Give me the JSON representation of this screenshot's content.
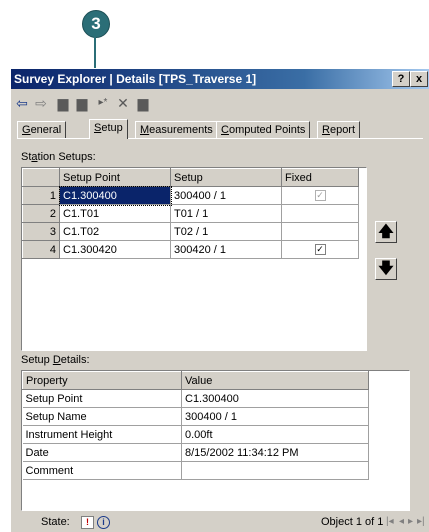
{
  "callout": {
    "number": "3"
  },
  "window": {
    "title": "Survey Explorer | Details [TPS_Traverse 1]",
    "help_button": "?",
    "close_button": "x"
  },
  "toolbar": {
    "back": "⇦",
    "forward": "⇨",
    "new": "▆",
    "save": "▆",
    "insert": "▸*",
    "delete": "✕",
    "props": "▆"
  },
  "tabs": [
    {
      "pre": "",
      "u": "G",
      "post": "eneral"
    },
    {
      "pre": "",
      "u": "S",
      "post": "etup"
    },
    {
      "pre": "",
      "u": "M",
      "post": "easurements"
    },
    {
      "pre": "",
      "u": "C",
      "post": "omputed Points"
    },
    {
      "pre": "",
      "u": "R",
      "post": "eport"
    }
  ],
  "station": {
    "label_pre": "St",
    "label_u": "a",
    "label_post": "tion Setups:",
    "columns": [
      "Setup Point",
      "Setup",
      "Fixed"
    ],
    "rows": [
      {
        "n": "1",
        "point": "C1.300400",
        "setup": "300400 / 1",
        "fixed": "✓",
        "fixed_state": "disabled"
      },
      {
        "n": "2",
        "point": "C1.T01",
        "setup": "T01 / 1",
        "fixed": "",
        "fixed_state": "none"
      },
      {
        "n": "3",
        "point": "C1.T02",
        "setup": "T02 / 1",
        "fixed": "",
        "fixed_state": "none"
      },
      {
        "n": "4",
        "point": "C1.300420",
        "setup": "300420 / 1",
        "fixed": "✓",
        "fixed_state": "checked"
      }
    ]
  },
  "move_up": "🡅",
  "move_down": "🡇",
  "details": {
    "label_pre": "Setup ",
    "label_u": "D",
    "label_post": "etails:",
    "columns": [
      "Property",
      "Value"
    ],
    "rows": [
      {
        "property": "Setup Point",
        "value": "C1.300400"
      },
      {
        "property": "Setup Name",
        "value": "300400 / 1"
      },
      {
        "property": "Instrument Height",
        "value": "0.00ft"
      },
      {
        "property": "Date",
        "value": "8/15/2002 11:34:12 PM"
      },
      {
        "property": "Comment",
        "value": ""
      }
    ]
  },
  "status": {
    "state_label": "State:",
    "state_icon_1": "!",
    "state_icon_2": "i",
    "object_text": "Object 1 of 1",
    "nav_first": "|◂",
    "nav_prev": "◂",
    "nav_next": "▸",
    "nav_last": "▸|"
  }
}
